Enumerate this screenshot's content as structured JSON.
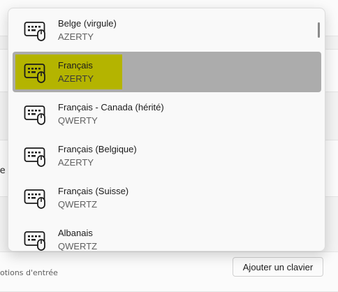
{
  "background": {
    "left_cut_text": "le",
    "options_text": "otions d'entrée",
    "add_keyboard_label": "Ajouter un clavier"
  },
  "flyout": {
    "items": [
      {
        "name": "Belge (virgule)",
        "layout": "AZERTY"
      },
      {
        "name": "Français",
        "layout": "AZERTY"
      },
      {
        "name": "Français - Canada (hérité)",
        "layout": "QWERTY"
      },
      {
        "name": "Français (Belgique)",
        "layout": "AZERTY"
      },
      {
        "name": "Français (Suisse)",
        "layout": "QWERTZ"
      },
      {
        "name": "Albanais",
        "layout": "QWERTZ"
      }
    ],
    "selected_index": 1
  },
  "icons": {
    "item_icon": "keyboard-mouse-icon"
  }
}
